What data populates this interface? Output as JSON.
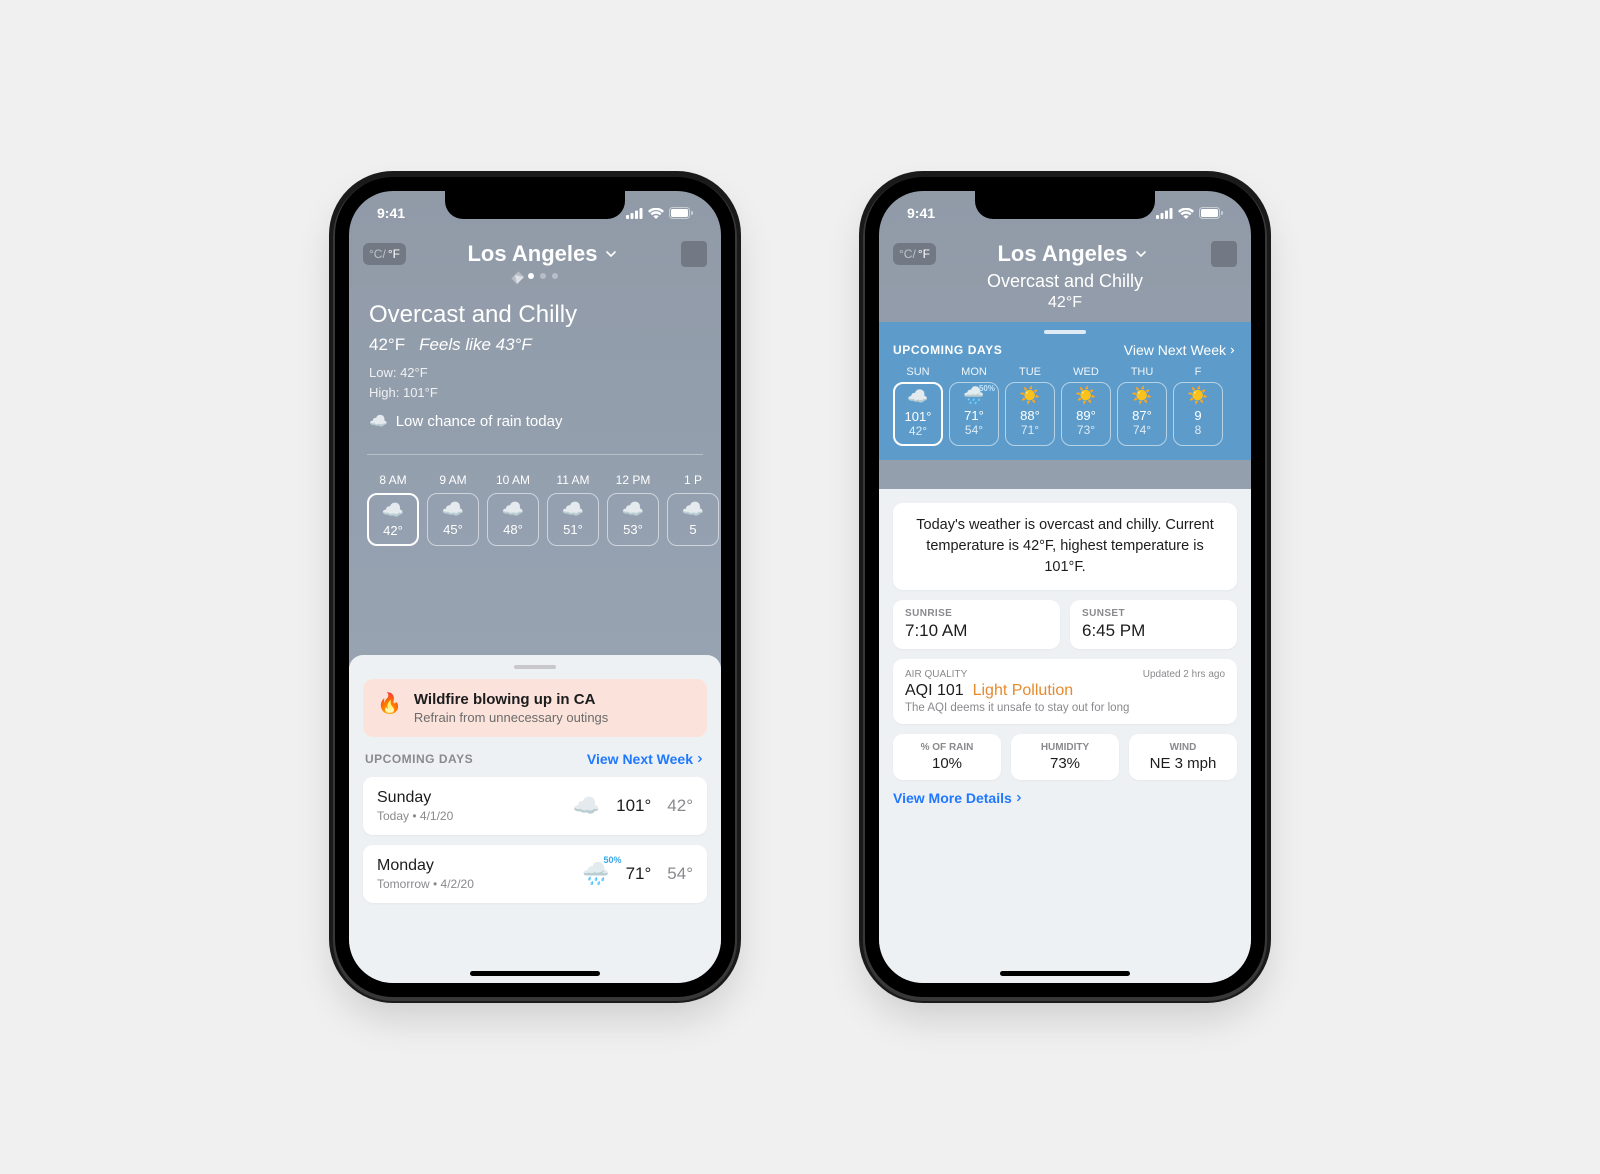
{
  "status": {
    "time": "9:41"
  },
  "unit_toggle": {
    "c": "°C/",
    "f": "°F"
  },
  "city": "Los Angeles",
  "p1": {
    "condition": "Overcast and Chilly",
    "temp": "42°F",
    "feels": "Feels like 43°F",
    "low": "Low: 42°F",
    "high": "High: 101°F",
    "rain_note": "Low chance of rain today",
    "hourly": [
      {
        "time": "8 AM",
        "icon": "cloud",
        "temp": "42°"
      },
      {
        "time": "9 AM",
        "icon": "cloud",
        "temp": "45°"
      },
      {
        "time": "10 AM",
        "icon": "cloud",
        "temp": "48°"
      },
      {
        "time": "11 AM",
        "icon": "cloud",
        "temp": "51°"
      },
      {
        "time": "12 PM",
        "icon": "cloud",
        "temp": "53°"
      },
      {
        "time": "1 P",
        "icon": "cloud",
        "temp": "5"
      }
    ],
    "alert": {
      "title": "Wildfire blowing up in CA",
      "sub": "Refrain from unnecessary outings"
    },
    "upcoming_label": "UPCOMING DAYS",
    "next_link": "View Next Week",
    "days": [
      {
        "day": "Sunday",
        "sub": "Today • 4/1/20",
        "icon": "cloud",
        "hi": "101°",
        "lo": "42°",
        "pct": ""
      },
      {
        "day": "Monday",
        "sub": "Tomorrow • 4/2/20",
        "icon": "rain",
        "hi": "71°",
        "lo": "54°",
        "pct": "50%"
      }
    ]
  },
  "p2": {
    "condition": "Overcast and Chilly",
    "temp": "42°F",
    "upcoming_label": "UPCOMING DAYS",
    "next_link": "View Next Week",
    "days": [
      {
        "abbr": "SUN",
        "icon": "cloud",
        "hi": "101°",
        "lo": "42°",
        "pct": ""
      },
      {
        "abbr": "MON",
        "icon": "rain",
        "hi": "71°",
        "lo": "54°",
        "pct": "50%"
      },
      {
        "abbr": "TUE",
        "icon": "sun",
        "hi": "88°",
        "lo": "71°",
        "pct": ""
      },
      {
        "abbr": "WED",
        "icon": "sun",
        "hi": "89°",
        "lo": "73°",
        "pct": ""
      },
      {
        "abbr": "THU",
        "icon": "sun",
        "hi": "87°",
        "lo": "74°",
        "pct": ""
      },
      {
        "abbr": "F",
        "icon": "sun",
        "hi": "9",
        "lo": "8",
        "pct": ""
      }
    ],
    "summary": "Today's weather is overcast and chilly. Current temperature is 42°F, highest temperature is 101°F.",
    "sunrise": {
      "label": "SUNRISE",
      "value": "7:10 AM"
    },
    "sunset": {
      "label": "SUNSET",
      "value": "6:45 PM"
    },
    "aqi": {
      "label": "AIR QUALITY",
      "updated": "Updated 2 hrs ago",
      "value": "AQI 101",
      "pollution": "Light Pollution",
      "note": "The AQI deems it unsafe to stay out for long"
    },
    "stats": [
      {
        "label": "% OF RAIN",
        "value": "10%"
      },
      {
        "label": "HUMIDITY",
        "value": "73%"
      },
      {
        "label": "WIND",
        "value": "NE 3 mph"
      }
    ],
    "more_link": "View More Details"
  }
}
